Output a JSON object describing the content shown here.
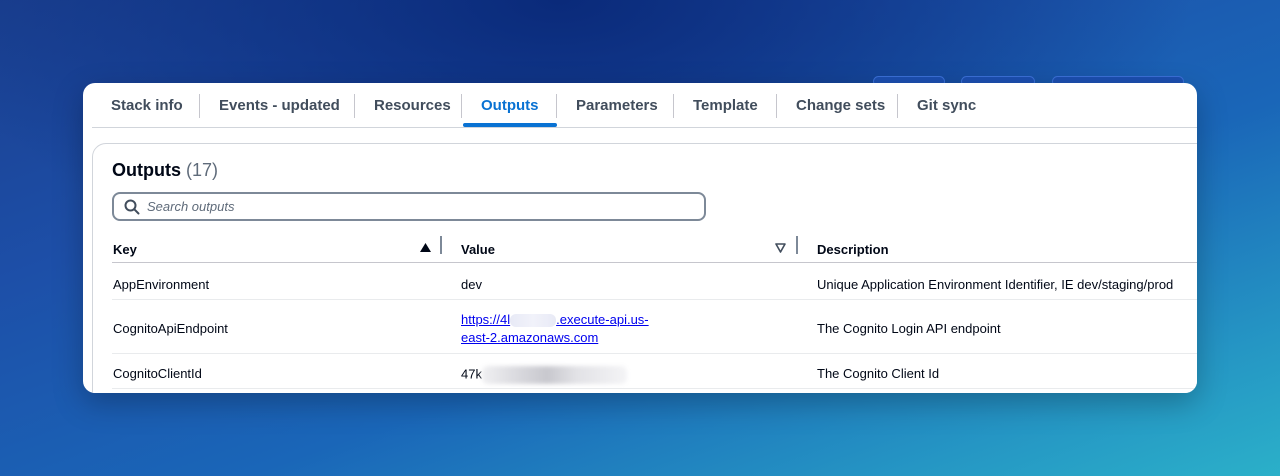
{
  "tabs": [
    {
      "label": "Stack info"
    },
    {
      "label": "Events - updated"
    },
    {
      "label": "Resources"
    },
    {
      "label": "Outputs",
      "active": true
    },
    {
      "label": "Parameters"
    },
    {
      "label": "Template"
    },
    {
      "label": "Change sets"
    },
    {
      "label": "Git sync"
    }
  ],
  "panel": {
    "title": "Outputs",
    "count": "(17)"
  },
  "search": {
    "placeholder": "Search outputs"
  },
  "table": {
    "columns": {
      "key": "Key",
      "value": "Value",
      "description": "Description"
    },
    "rows": [
      {
        "key": "AppEnvironment",
        "value": "dev",
        "description": "Unique Application Environment Identifier, IE dev/staging/prod"
      },
      {
        "key": "CognitoApiEndpoint",
        "value_prefix": "https://4l",
        "value_suffix": ".execute-api.us-",
        "value_line2": "east-2.amazonaws.com",
        "description": "The Cognito Login API endpoint"
      },
      {
        "key": "CognitoClientId",
        "value_prefix": "47k",
        "description": "The Cognito Client Id"
      }
    ]
  },
  "colors": {
    "accent": "#0972d3",
    "link": "#0000ee",
    "text": "#000716"
  }
}
